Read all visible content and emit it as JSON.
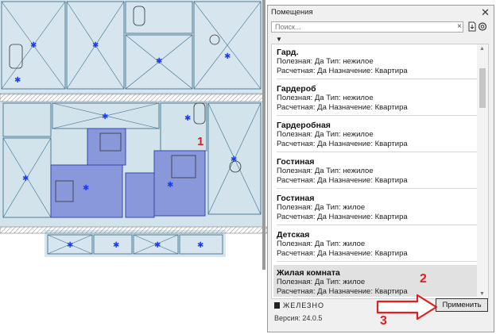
{
  "plan": {
    "label": "1"
  },
  "panel": {
    "title": "Помещения",
    "close_glyph": "✕",
    "search_placeholder": "Поиск...",
    "search_clear": "×",
    "sort_glyph": "▼",
    "items": [
      {
        "name": "Гард.",
        "useful": "Полезная: Да",
        "type": "Тип: нежилое",
        "calc": "Расчетная: Да",
        "purpose": "Назначение: Квартира"
      },
      {
        "name": "Гардероб",
        "useful": "Полезная: Да",
        "type": "Тип: нежилое",
        "calc": "Расчетная: Да",
        "purpose": "Назначение: Квартира"
      },
      {
        "name": "Гардеробная",
        "useful": "Полезная: Да",
        "type": "Тип: нежилое",
        "calc": "Расчетная: Да",
        "purpose": "Назначение: Квартира"
      },
      {
        "name": "Гостиная",
        "useful": "Полезная: Да",
        "type": "Тип: нежилое",
        "calc": "Расчетная: Да",
        "purpose": "Назначение: Квартира"
      },
      {
        "name": "Гостиная",
        "useful": "Полезная: Да",
        "type": "Тип: жилое",
        "calc": "Расчетная: Да",
        "purpose": "Назначение: Квартира"
      },
      {
        "name": "Детская",
        "useful": "Полезная: Да",
        "type": "Тип: жилое",
        "calc": "Расчетная: Да",
        "purpose": "Назначение: Квартира"
      },
      {
        "name": "Жилая комната",
        "useful": "Полезная: Да",
        "type": "Тип: жилое",
        "calc": "Расчетная: Да",
        "purpose": "Назначение: Квартира"
      }
    ],
    "brand": "ЖЕЛЕЗНО",
    "version": "Версия: 24.0.5",
    "apply_label": "Применить"
  },
  "annotations": {
    "step2": "2",
    "step3": "3"
  },
  "colors": {
    "selection": "#6f7fd6",
    "wall": "#7a7a7a",
    "room_fill": "#cfe1ea",
    "marker_red": "#e02020"
  }
}
